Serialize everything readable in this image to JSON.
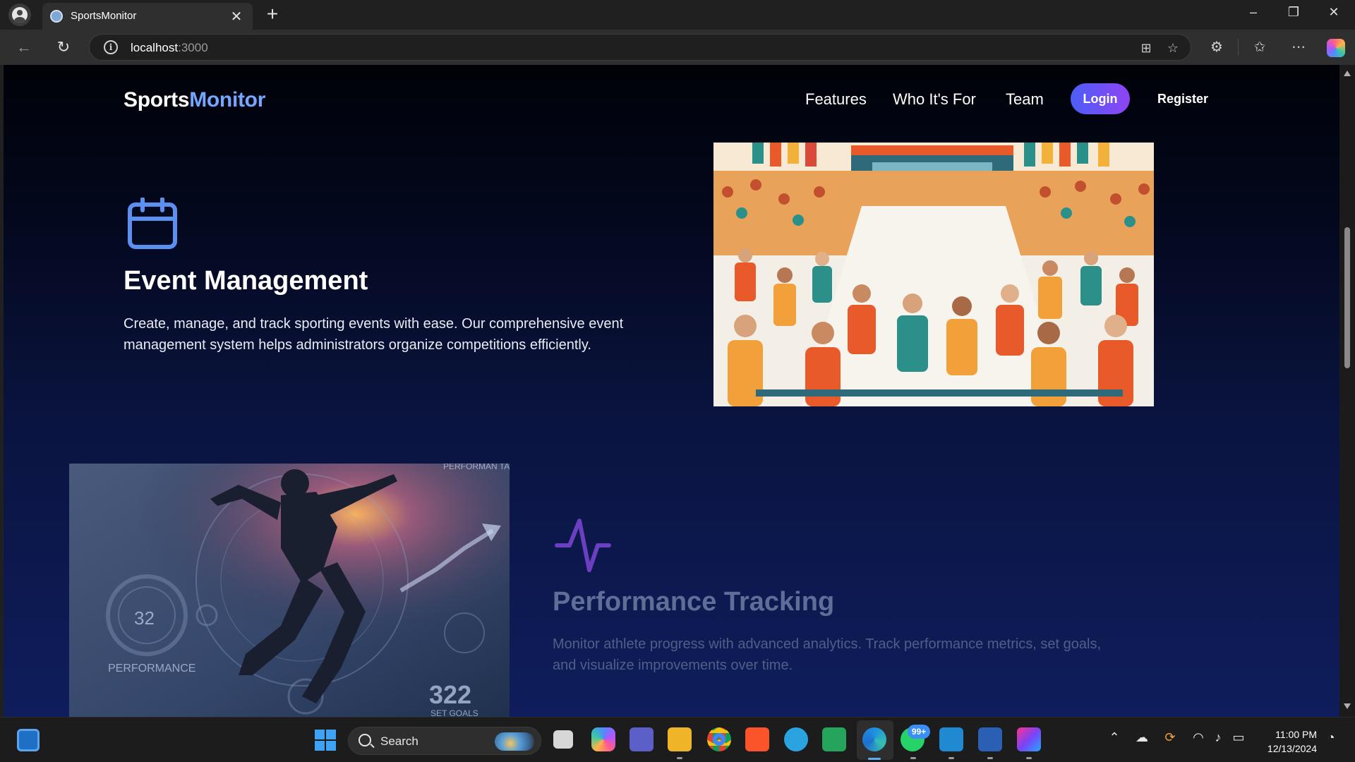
{
  "browser": {
    "tab_title": "SportsMonitor",
    "url_host": "localhost",
    "url_port": ":3000",
    "icons": [
      "back-icon",
      "reload-icon",
      "info-icon",
      "split-screen-icon",
      "favorite-star-icon",
      "extensions-icon",
      "favorites-icon",
      "more-icon",
      "copilot-icon"
    ]
  },
  "site": {
    "logo_part1": "Sports",
    "logo_part2": "Monitor",
    "nav": [
      {
        "label": "Features"
      },
      {
        "label": "Who It's For"
      },
      {
        "label": "Team"
      }
    ],
    "login_label": "Login",
    "register_label": "Register"
  },
  "features": [
    {
      "title": "Event Management",
      "description": "Create, manage, and track sporting events with ease. Our comprehensive event management system helps administrators organize competitions efficiently.",
      "icon": "calendar-icon",
      "icon_color": "#5b8ff0"
    },
    {
      "title": "Performance Tracking",
      "description": "Monitor athlete progress with advanced analytics. Track performance metrics, set goals, and visualize improvements over time.",
      "icon": "activity-icon",
      "icon_color": "#6a3fc0"
    }
  ],
  "perf_image": {
    "text_top": "PERFORMAN\nTANTALTINCS",
    "gauge_value": "32",
    "gauge_label": "PERFORMANCE",
    "big_number": "322",
    "small_label": "SET GOALS"
  },
  "taskbar": {
    "search_label": "Search",
    "whatsapp_badge": "99+",
    "time": "11:00 PM",
    "date": "12/13/2024"
  },
  "colors": {
    "logo_accent": "#74a7ff",
    "login_gradient_start": "#4d5ef6",
    "login_gradient_end": "#8e44f5"
  }
}
